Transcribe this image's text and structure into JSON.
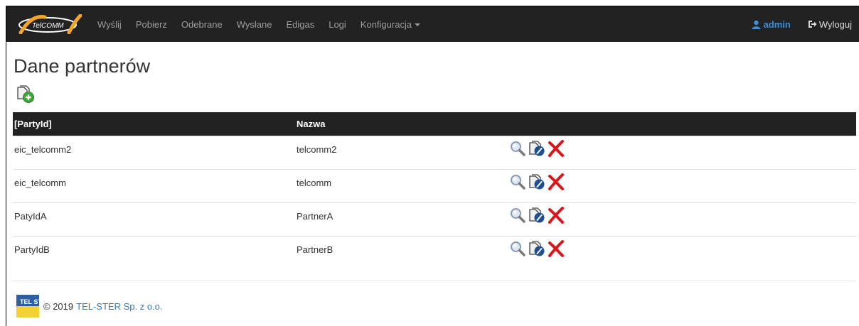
{
  "nav": {
    "logo_text": "TelCOMM",
    "links": [
      "Wyślij",
      "Pobierz",
      "Odebrane",
      "Wysłane",
      "Edigas",
      "Logi",
      "Konfiguracja"
    ],
    "user": "admin",
    "logout": "Wyloguj"
  },
  "page": {
    "title": "Dane partnerów"
  },
  "table": {
    "headers": [
      "[PartyId]",
      "Nazwa",
      ""
    ],
    "rows": [
      {
        "party_id": "eic_telcomm2",
        "name": "telcomm2"
      },
      {
        "party_id": "eic_telcomm",
        "name": "telcomm"
      },
      {
        "party_id": "PatyIdA",
        "name": "PartnerA"
      },
      {
        "party_id": "PartyIdB",
        "name": "PartnerB"
      }
    ]
  },
  "footer": {
    "logo_text": "TEL STER",
    "copyright": "© 2019",
    "company": "TEL-STER Sp. z o.o."
  },
  "colors": {
    "navbar": "#222222",
    "accent": "#337ab7",
    "delete": "#d9161c"
  }
}
